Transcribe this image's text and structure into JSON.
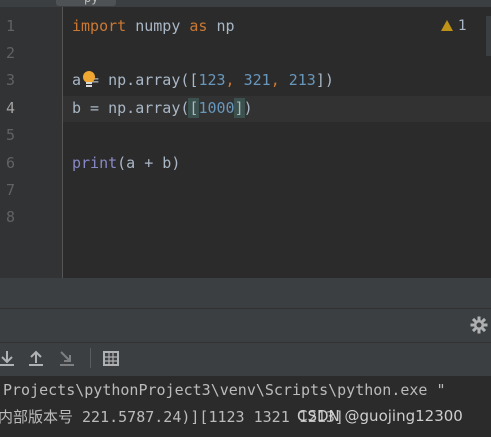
{
  "tab": {
    "label": "py"
  },
  "editor": {
    "line_numbers": [
      "1",
      "2",
      "3",
      "4",
      "5",
      "6",
      "7",
      "8"
    ],
    "current_line": "4",
    "inspection": {
      "count": "1",
      "color": "#be9117"
    },
    "code": {
      "line1": {
        "kw_import": "import",
        "module": " numpy ",
        "kw_as": "as",
        "alias": " np"
      },
      "line3": {
        "var": "a",
        "eq": " = np.array([",
        "n1": "123",
        "c1": ", ",
        "n2": "321",
        "c2": ", ",
        "n3": "213",
        "end": "])"
      },
      "line4": {
        "prefix": "b = np.array(",
        "open": "[",
        "n1": "1000",
        "close": "]",
        "end": ")"
      },
      "line6": {
        "fn": "print",
        "args": "(a + b)"
      }
    }
  },
  "console": {
    "line1": "Projects\\pythonProject3\\venv\\Scripts\\python.exe \"",
    "line2_prefix": "内部版本号 221.5787.24)][1123 1321 1213]",
    "watermark": "CSDN @guojing12300"
  },
  "colors": {
    "background": "#2b2b2b",
    "keyword": "#cc7832",
    "number": "#6897bb",
    "builtin": "#8888c6",
    "text": "#a9b7c6"
  }
}
